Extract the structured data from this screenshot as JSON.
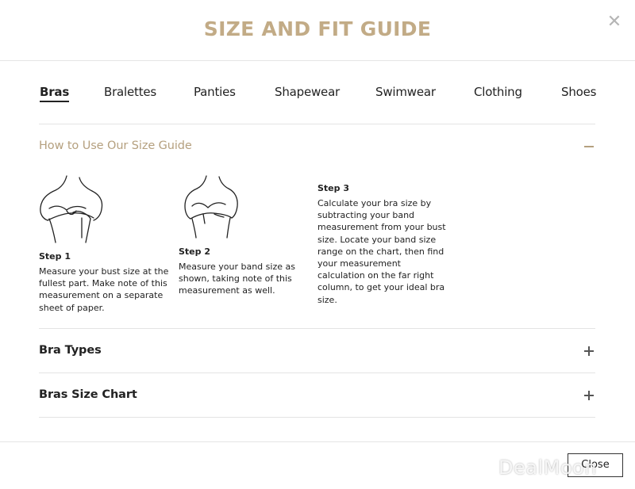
{
  "modal": {
    "title": "SIZE AND FIT GUIDE",
    "close_icon": "close-icon",
    "close_button_label": "Close"
  },
  "tabs": [
    {
      "label": "Bras",
      "active": true
    },
    {
      "label": "Bralettes",
      "active": false
    },
    {
      "label": "Panties",
      "active": false
    },
    {
      "label": "Shapewear",
      "active": false
    },
    {
      "label": "Swimwear",
      "active": false
    },
    {
      "label": "Clothing",
      "active": false
    },
    {
      "label": "Shoes",
      "active": false
    }
  ],
  "accordion": [
    {
      "title": "How to Use Our Size Guide",
      "expanded": true,
      "steps": [
        {
          "label": "Step 1",
          "lines": [
            "Measure your bust size at the",
            "fullest part. Make note of this",
            "measurement on a separate",
            "sheet of paper."
          ],
          "icon": "bust-measure-illustration"
        },
        {
          "label": "Step 2",
          "lines": [
            "Measure your band size as",
            "shown, taking note of this",
            "measurement as well."
          ],
          "icon": "band-measure-illustration"
        },
        {
          "label": "Step 3",
          "lines": [
            "Calculate your bra size by",
            "subtracting your band",
            "measurement from your bust",
            "size. Locate your band size",
            "range on the chart, then find",
            "your measurement",
            "calculation on the far right",
            "column, to get your ideal bra",
            "size."
          ]
        }
      ]
    },
    {
      "title": "Bra Types",
      "expanded": false
    },
    {
      "title": "Bras Size Chart",
      "expanded": false
    }
  ],
  "watermark": "DealMoon",
  "colors": {
    "accent": "#c2ab86",
    "accordion_open": "#b5a07f",
    "text": "#222222",
    "divider": "#e3e3e3"
  }
}
